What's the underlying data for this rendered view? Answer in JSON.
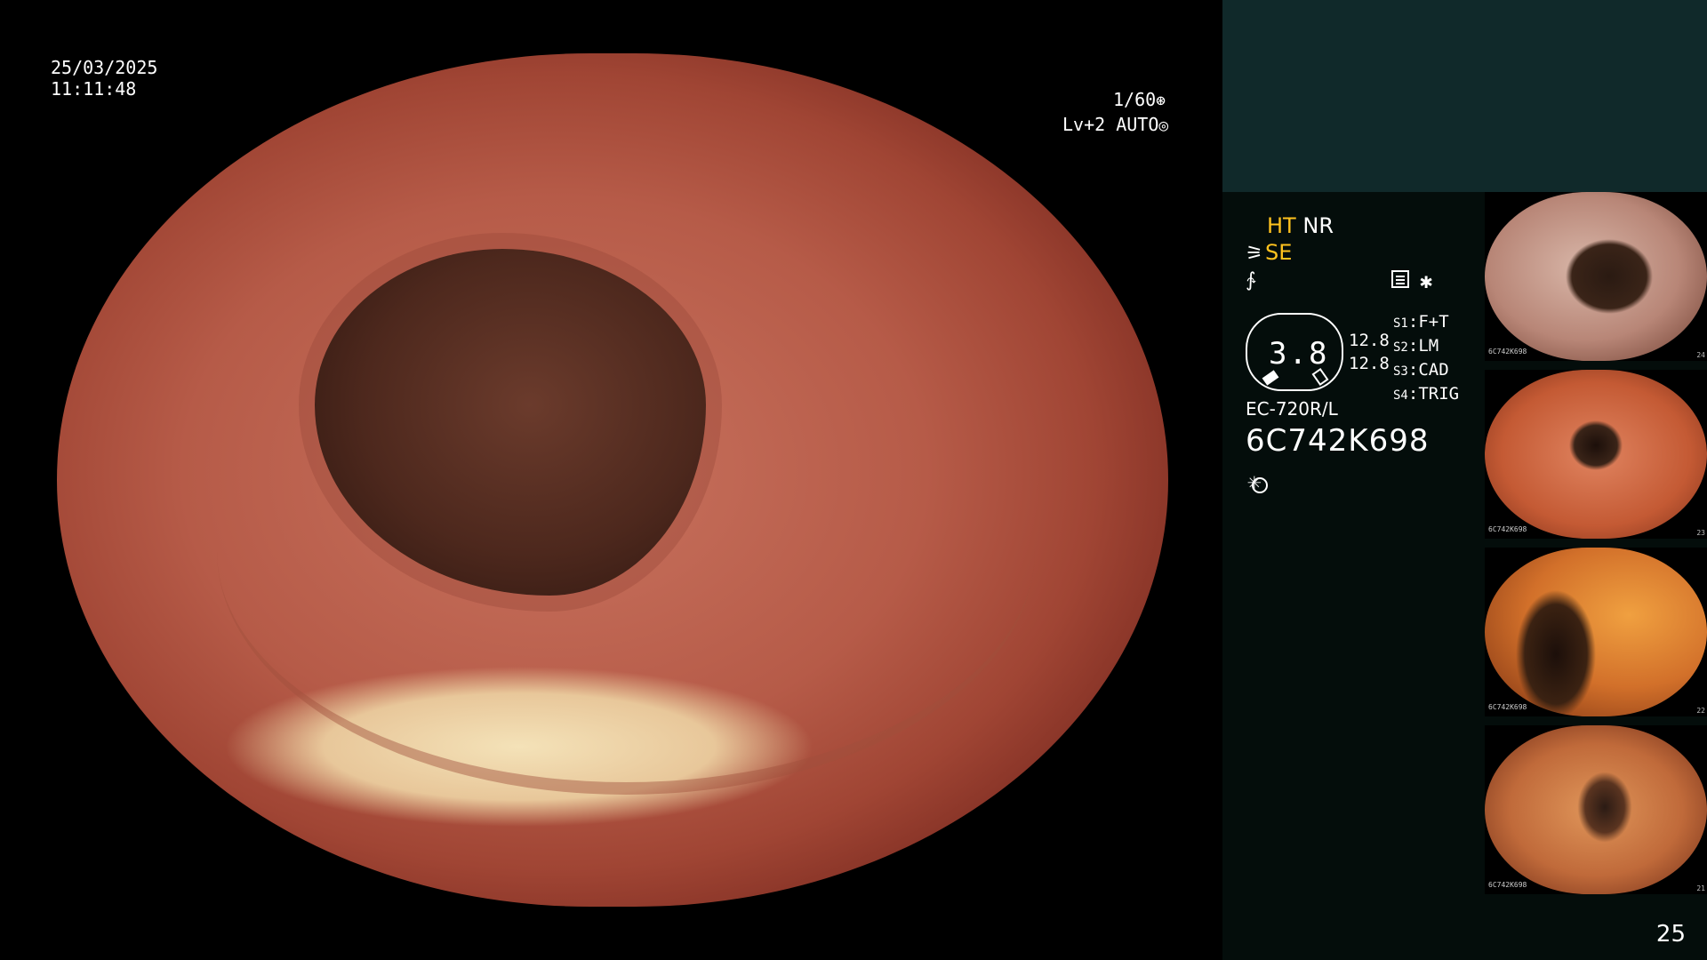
{
  "overlay": {
    "date": "25/03/2025",
    "time": "11:11:48",
    "shutter": "1/60",
    "level": "Lv+2 AUTO"
  },
  "modes": {
    "ht": "HT",
    "nr": "NR",
    "se": "SE"
  },
  "dial": {
    "value": "3.8",
    "side_top": "12.8",
    "side_bottom": "12.8"
  },
  "switches": [
    {
      "key": "S1",
      "value": "F+T"
    },
    {
      "key": "S2",
      "value": "LM"
    },
    {
      "key": "S3",
      "value": "CAD"
    },
    {
      "key": "S4",
      "value": "TRIG"
    }
  ],
  "scope": {
    "model": "EC-720R/L",
    "serial": "6C742K698"
  },
  "icons": {
    "shutter": "shutter-icon",
    "iris": "iris-icon",
    "histogram": "histogram-icon",
    "asterisk": "asterisk-icon",
    "light": "light-icon"
  },
  "thumbnails": [
    {
      "number": "24",
      "serial": "6C742K698"
    },
    {
      "number": "23",
      "serial": "6C742K698"
    },
    {
      "number": "22",
      "serial": "6C742K698"
    },
    {
      "number": "21",
      "serial": "6C742K698"
    }
  ],
  "page_number": "25"
}
